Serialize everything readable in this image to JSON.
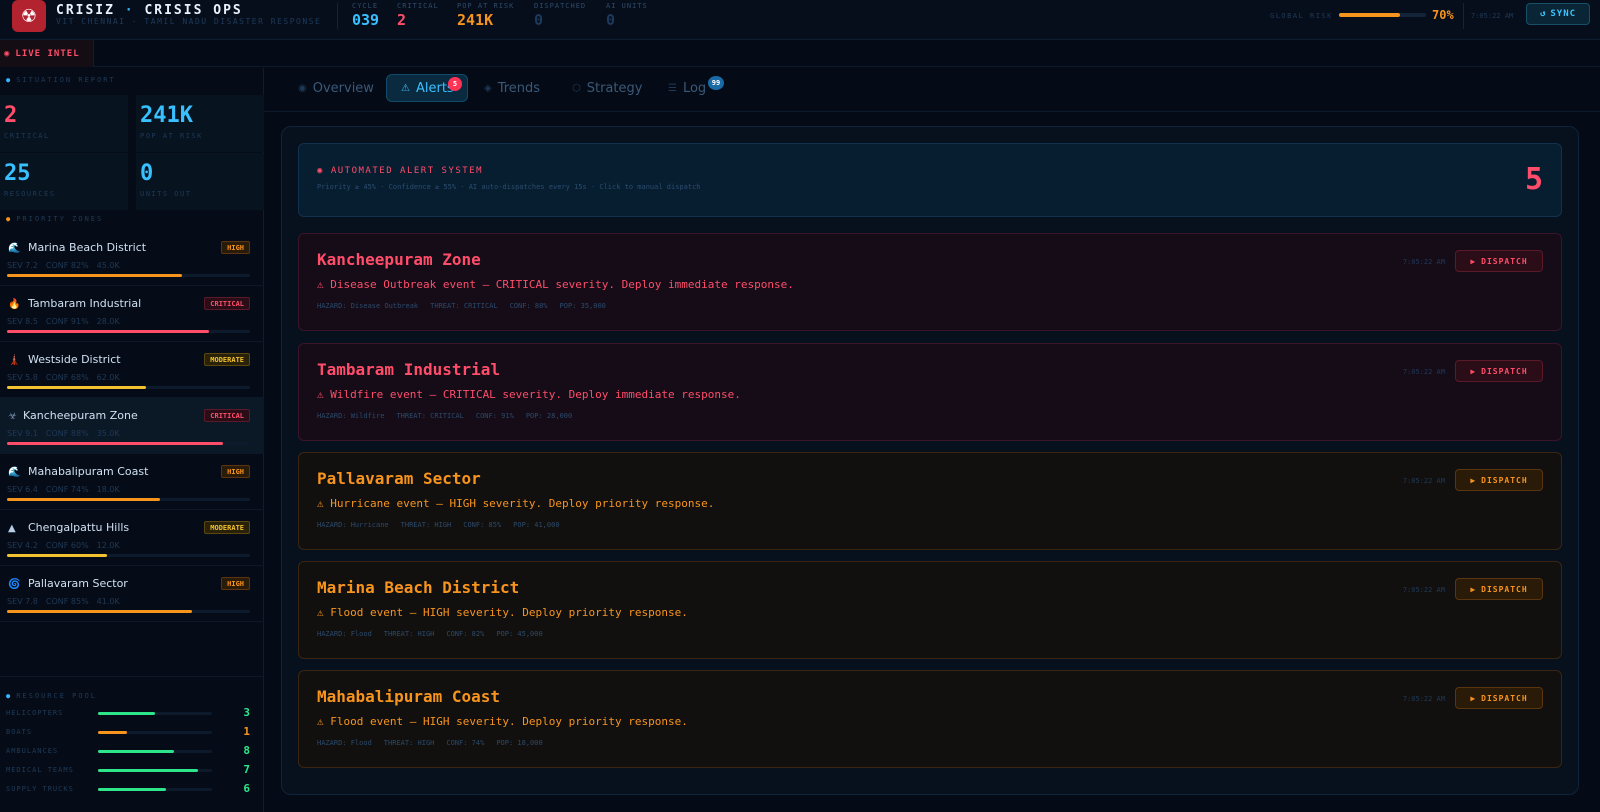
{
  "colors": {
    "critical": "#ff4d6a",
    "high": "#f7941e",
    "moderate": "#f2c230",
    "accent": "#39c0ff",
    "green": "#2ee68a",
    "muted": "#1f3a58"
  },
  "header": {
    "logo_icon": "biohazard-icon",
    "title_left": "CRISIZ",
    "title_sep": "·",
    "title_right": "CRISIS OPS",
    "subtitle": "VIT CHENNAI · TAMIL NADU DISASTER RESPONSE",
    "stats": [
      {
        "label": "CYCLE",
        "value": "039",
        "color": "#39c0ff"
      },
      {
        "label": "CRITICAL",
        "value": "2",
        "color": "#ff4d6a"
      },
      {
        "label": "POP AT RISK",
        "value": "241K",
        "color": "#f7941e"
      },
      {
        "label": "DISPATCHED",
        "value": "0",
        "color": "#1e3a5a"
      },
      {
        "label": "AI UNITS",
        "value": "0",
        "color": "#1e3a5a"
      }
    ],
    "global_risk_label": "GLOBAL RISK",
    "global_risk_pct": 70,
    "global_risk_text": "70%",
    "time": "7:05:22 AM",
    "sync_icon": "refresh-icon",
    "sync_label": "SYNC"
  },
  "intel": {
    "label": "LIVE INTEL"
  },
  "sidebar": {
    "situation_title": "SITUATION REPORT",
    "kpis": [
      {
        "value": "2",
        "label": "CRITICAL",
        "color": "#ff4d6a"
      },
      {
        "value": "241K",
        "label": "POP AT RISK",
        "color": "#39c0ff"
      },
      {
        "value": "25",
        "label": "RESOURCES",
        "color": "#39c0ff"
      },
      {
        "value": "0",
        "label": "UNITS OUT",
        "color": "#39c0ff"
      }
    ],
    "priority_title": "PRIORITY ZONES",
    "zones": [
      {
        "name": "Marina Beach District",
        "icon": "🌊",
        "level": "HIGH",
        "sev": "SEV 7.2",
        "conf": "CONF 82%",
        "pop": "45.0K",
        "fill": 0.72,
        "color": "#f7941e",
        "active": false
      },
      {
        "name": "Tambaram Industrial",
        "icon": "🔥",
        "level": "CRITICAL",
        "sev": "SEV 8.5",
        "conf": "CONF 91%",
        "pop": "28.0K",
        "fill": 0.83,
        "color": "#ff4d6a",
        "active": false
      },
      {
        "name": "Westside District",
        "icon": "🗼",
        "level": "MODERATE",
        "sev": "SEV 5.8",
        "conf": "CONF 68%",
        "pop": "62.0K",
        "fill": 0.57,
        "color": "#f2c230",
        "active": false
      },
      {
        "name": "Kancheepuram Zone",
        "icon": "☣",
        "level": "CRITICAL",
        "sev": "SEV 9.1",
        "conf": "CONF 88%",
        "pop": "35.0K",
        "fill": 0.89,
        "color": "#ff4d6a",
        "active": true
      },
      {
        "name": "Mahabalipuram Coast",
        "icon": "🌊",
        "level": "HIGH",
        "sev": "SEV 6.4",
        "conf": "CONF 74%",
        "pop": "18.0K",
        "fill": 0.63,
        "color": "#f7941e",
        "active": false
      },
      {
        "name": "Chengalpattu Hills",
        "icon": "▲",
        "level": "MODERATE",
        "sev": "SEV 4.2",
        "conf": "CONF 60%",
        "pop": "12.0K",
        "fill": 0.41,
        "color": "#f2c230",
        "active": false
      },
      {
        "name": "Pallavaram Sector",
        "icon": "🌀",
        "level": "HIGH",
        "sev": "SEV 7.8",
        "conf": "CONF 85%",
        "pop": "41.0K",
        "fill": 0.76,
        "color": "#f7941e",
        "active": false
      }
    ],
    "resource_title": "RESOURCE POOL",
    "resources": [
      {
        "label": "HELICOPTERS",
        "value": "3",
        "fill": 0.5,
        "color": "#2ee68a"
      },
      {
        "label": "BOATS",
        "value": "1",
        "fill": 0.25,
        "color": "#f7941e"
      },
      {
        "label": "AMBULANCES",
        "value": "8",
        "fill": 0.67,
        "color": "#2ee68a"
      },
      {
        "label": "MEDICAL TEAMS",
        "value": "7",
        "fill": 0.88,
        "color": "#2ee68a"
      },
      {
        "label": "SUPPLY TRUCKS",
        "value": "6",
        "fill": 0.6,
        "color": "#2ee68a"
      }
    ]
  },
  "tabs": [
    {
      "label": "Overview",
      "icon": "◉",
      "active": false
    },
    {
      "label": "Alerts",
      "icon": "⚠",
      "active": true,
      "badge": "5"
    },
    {
      "label": "Trends",
      "icon": "◈",
      "active": false
    },
    {
      "label": "Strategy",
      "icon": "⬡",
      "active": false
    },
    {
      "label": "Log",
      "icon": "☰",
      "active": false,
      "badge": "99"
    }
  ],
  "alert_system": {
    "title": "AUTOMATED ALERT SYSTEM",
    "description": "Priority ≥ 45% · Confidence ≥ 55% · AI auto-dispatches every 15s · Click to manual dispatch",
    "count": "5"
  },
  "alerts": [
    {
      "title": "Kancheepuram Zone",
      "level": "critical",
      "message": "⚠ Disease Outbreak event — CRITICAL severity. Deploy immediate response.",
      "hazard": "HAZARD: Disease Outbreak",
      "threat": "THREAT: CRITICAL",
      "conf": "CONF: 88%",
      "pop": "POP: 35,000",
      "time": "7:05:22 AM",
      "button": "DISPATCH"
    },
    {
      "title": "Tambaram Industrial",
      "level": "critical",
      "message": "⚠ Wildfire event — CRITICAL severity. Deploy immediate response.",
      "hazard": "HAZARD: Wildfire",
      "threat": "THREAT: CRITICAL",
      "conf": "CONF: 91%",
      "pop": "POP: 28,000",
      "time": "7:05:22 AM",
      "button": "DISPATCH"
    },
    {
      "title": "Pallavaram Sector",
      "level": "high",
      "message": "⚠ Hurricane event — HIGH severity. Deploy priority response.",
      "hazard": "HAZARD: Hurricane",
      "threat": "THREAT: HIGH",
      "conf": "CONF: 85%",
      "pop": "POP: 41,000",
      "time": "7:05:22 AM",
      "button": "DISPATCH"
    },
    {
      "title": "Marina Beach District",
      "level": "high",
      "message": "⚠ Flood event — HIGH severity. Deploy priority response.",
      "hazard": "HAZARD: Flood",
      "threat": "THREAT: HIGH",
      "conf": "CONF: 82%",
      "pop": "POP: 45,000",
      "time": "7:05:22 AM",
      "button": "DISPATCH"
    },
    {
      "title": "Mahabalipuram Coast",
      "level": "high",
      "message": "⚠ Flood event — HIGH severity. Deploy priority response.",
      "hazard": "HAZARD: Flood",
      "threat": "THREAT: HIGH",
      "conf": "CONF: 74%",
      "pop": "POP: 18,000",
      "time": "7:05:22 AM",
      "button": "DISPATCH"
    }
  ]
}
